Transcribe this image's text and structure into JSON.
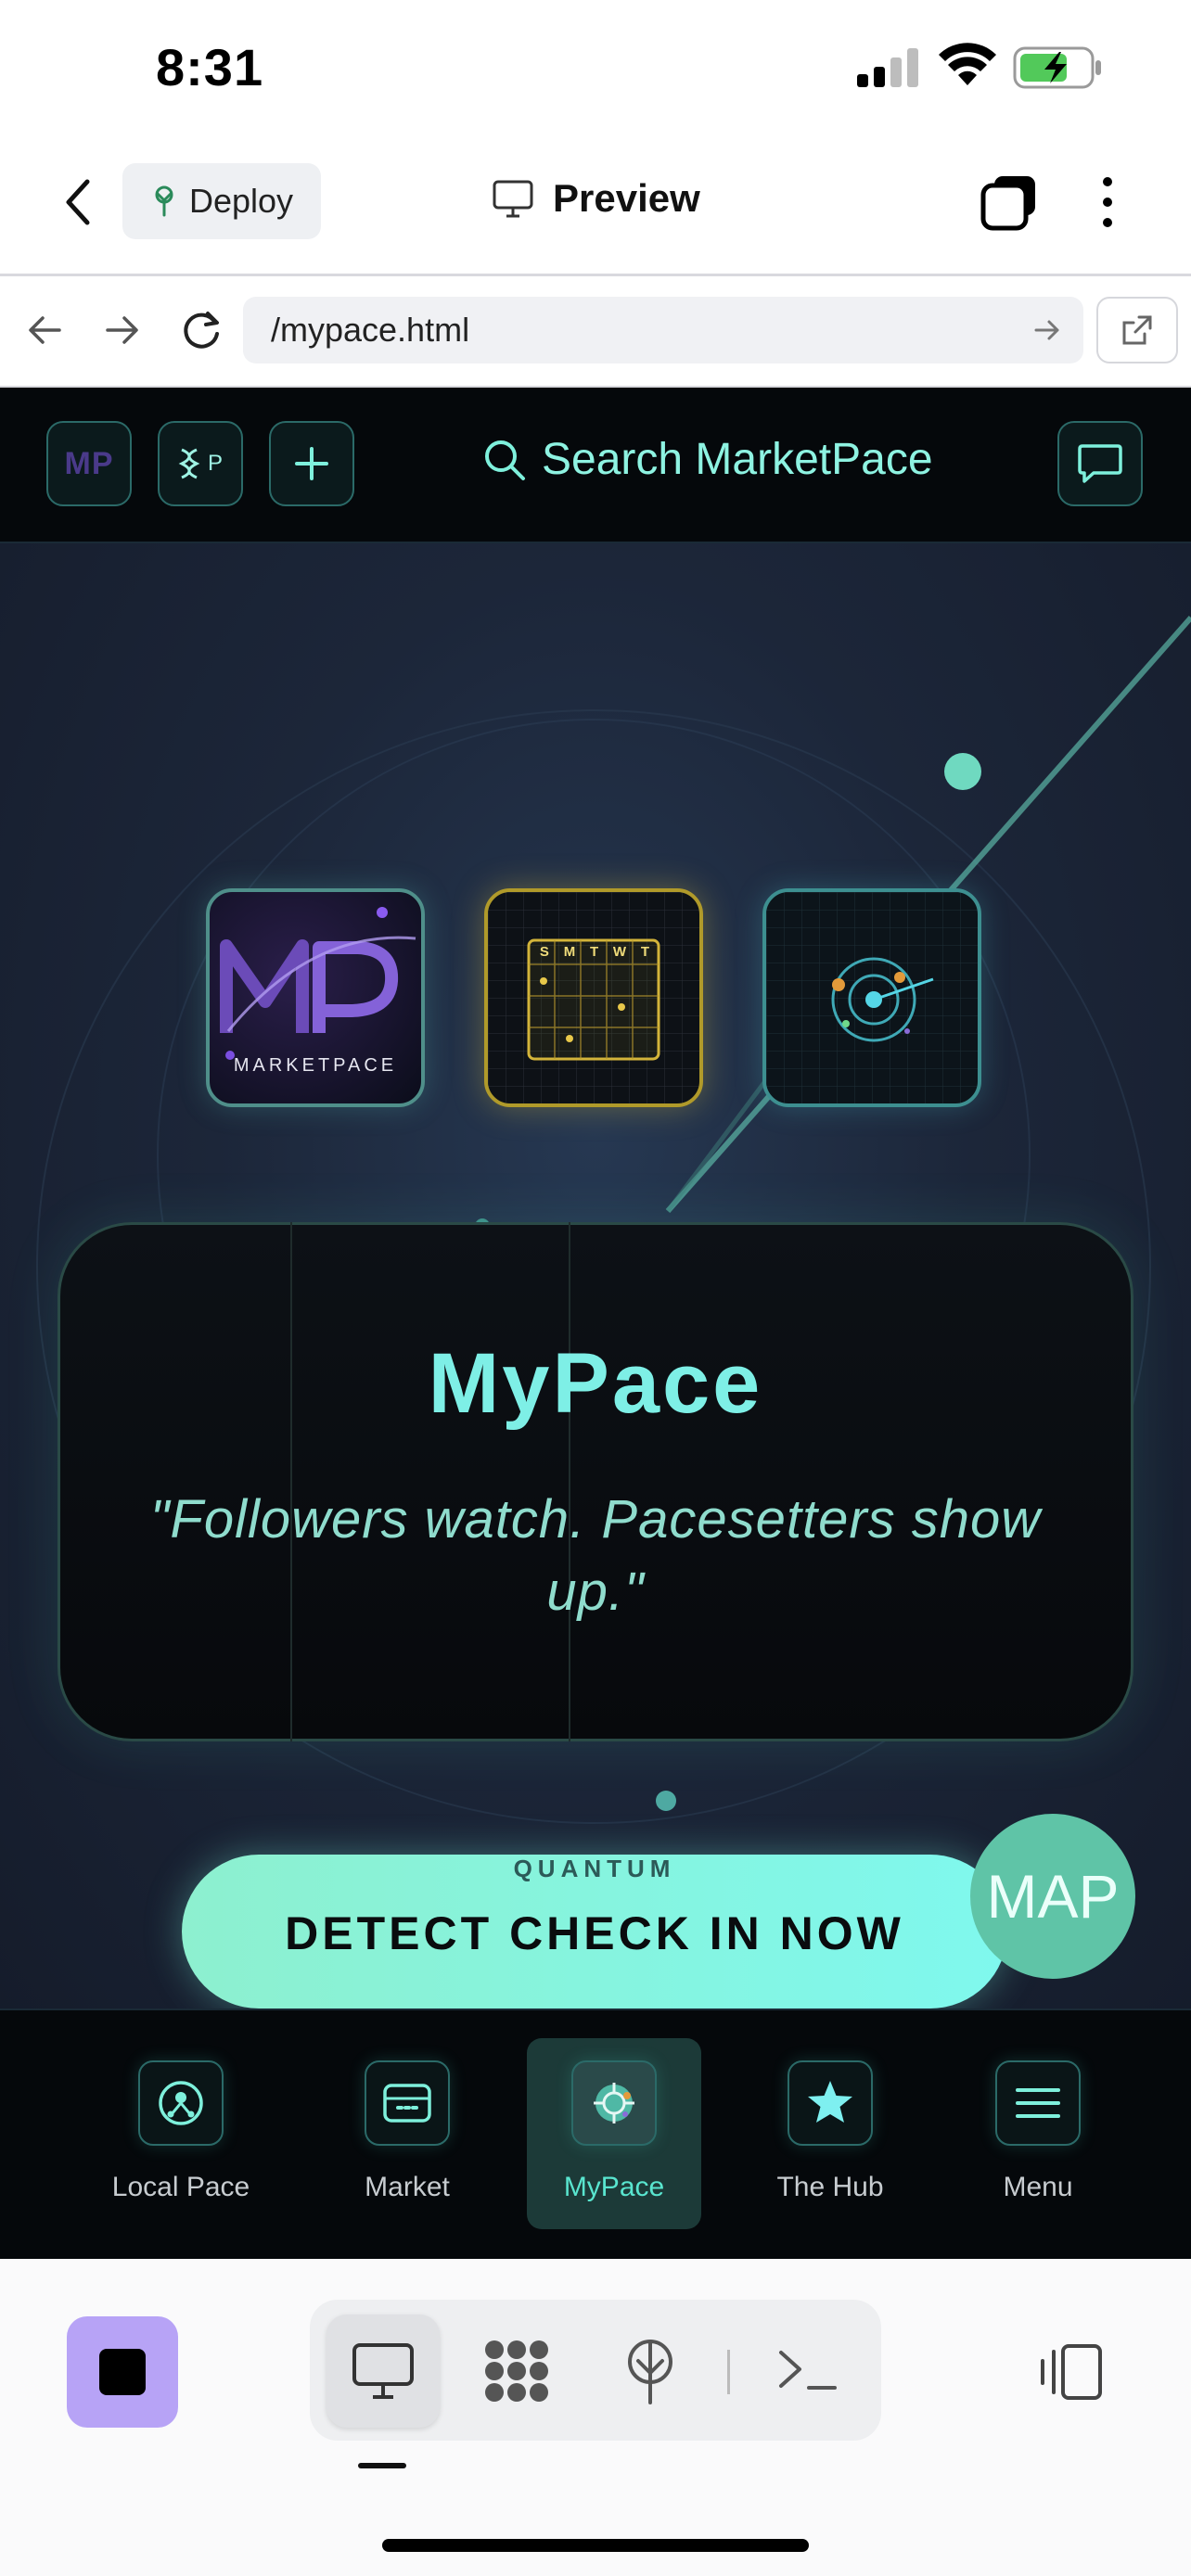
{
  "status_bar": {
    "time": "8:31"
  },
  "app_header": {
    "deploy_label": "Deploy",
    "title": "Preview"
  },
  "browser": {
    "url": "/mypace.html"
  },
  "site": {
    "top_buttons": {
      "mp_label": "MP",
      "profile_label": "P"
    },
    "search_placeholder": "Search MarketPace",
    "tiles": {
      "logo_text": "MARKETPACE",
      "calendar_days": [
        "S",
        "M",
        "T",
        "W",
        "T"
      ]
    },
    "card": {
      "title": "MyPace",
      "quote": "\"Followers watch. Pacesetters show up.\""
    },
    "cta": {
      "kicker": "QUANTUM",
      "label": "DETECT CHECK IN NOW"
    },
    "map_label": "MAP",
    "nav": [
      {
        "label": "Local Pace",
        "icon": "local-pace-icon"
      },
      {
        "label": "Market",
        "icon": "market-icon"
      },
      {
        "label": "MyPace",
        "icon": "mypace-icon",
        "active": true
      },
      {
        "label": "The Hub",
        "icon": "star-icon"
      },
      {
        "label": "Menu",
        "icon": "menu-icon"
      }
    ]
  },
  "colors": {
    "accent": "#7eefe6",
    "site_bg": "#1b2436",
    "cta_start": "#8df0cf",
    "cta_end": "#7ff8ee",
    "map_bubble": "#5fc4a7",
    "stop_button": "#b7a3f6"
  }
}
